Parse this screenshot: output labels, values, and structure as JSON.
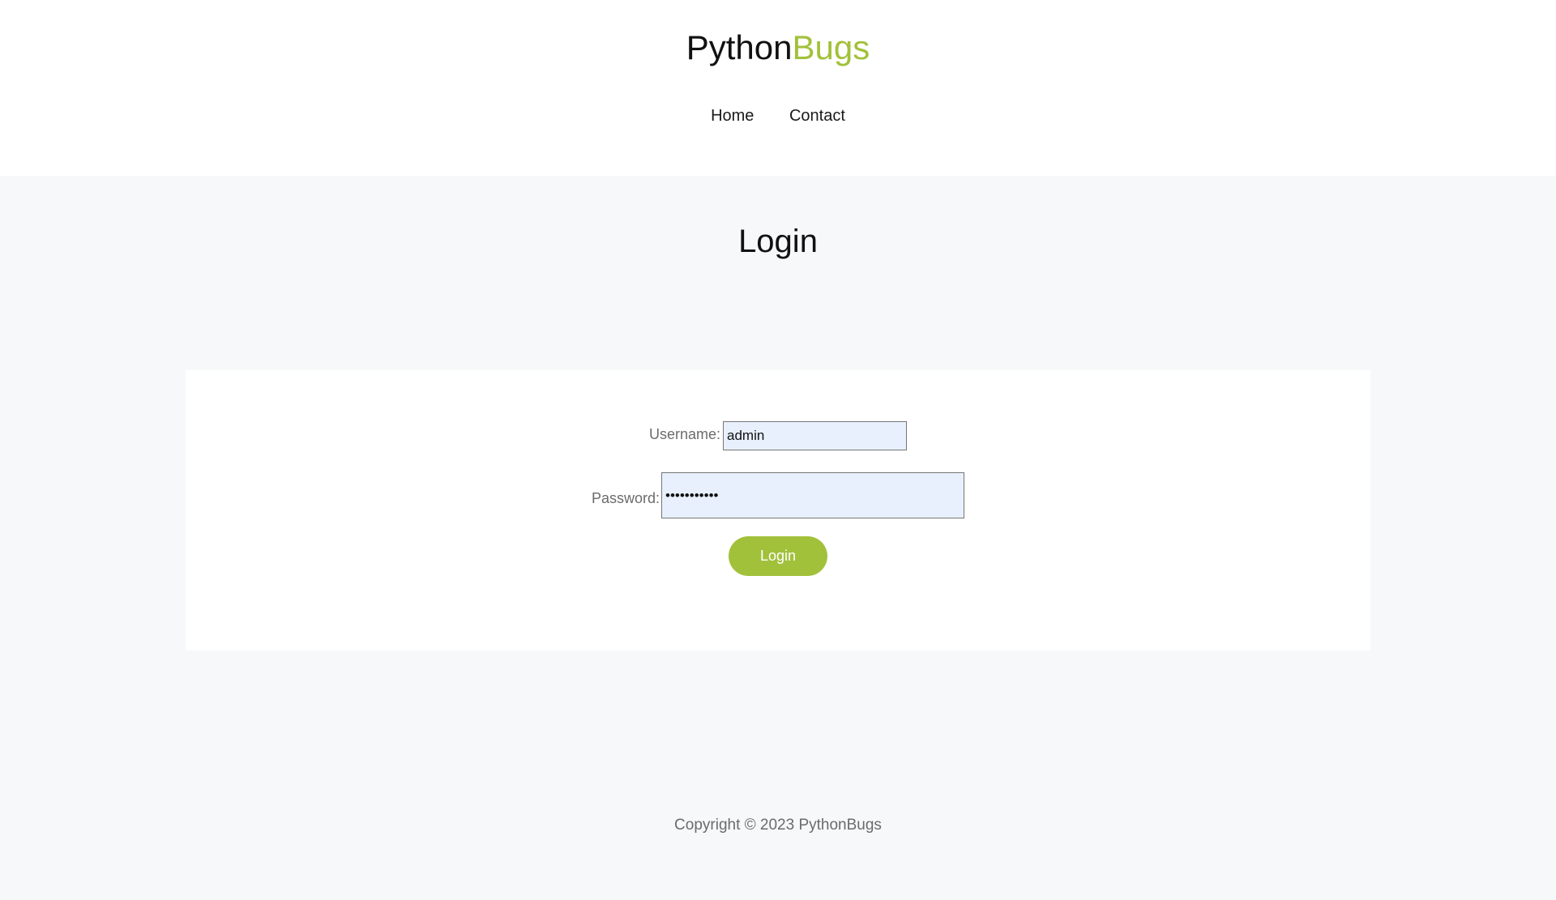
{
  "header": {
    "logo": {
      "part1": "Python",
      "part2": "Bugs"
    },
    "nav": [
      {
        "label": "Home"
      },
      {
        "label": "Contact"
      }
    ]
  },
  "main": {
    "title": "Login",
    "form": {
      "username_label": "Username:",
      "username_value": "admin",
      "password_label": "Password:",
      "password_value": "adminadmin1",
      "submit_label": "Login"
    }
  },
  "footer": {
    "copyright": "Copyright © 2023 PythonBugs"
  },
  "colors": {
    "accent": "#a2c13b",
    "page_background": "#f7f8f9",
    "input_background": "#e8f0fe"
  }
}
